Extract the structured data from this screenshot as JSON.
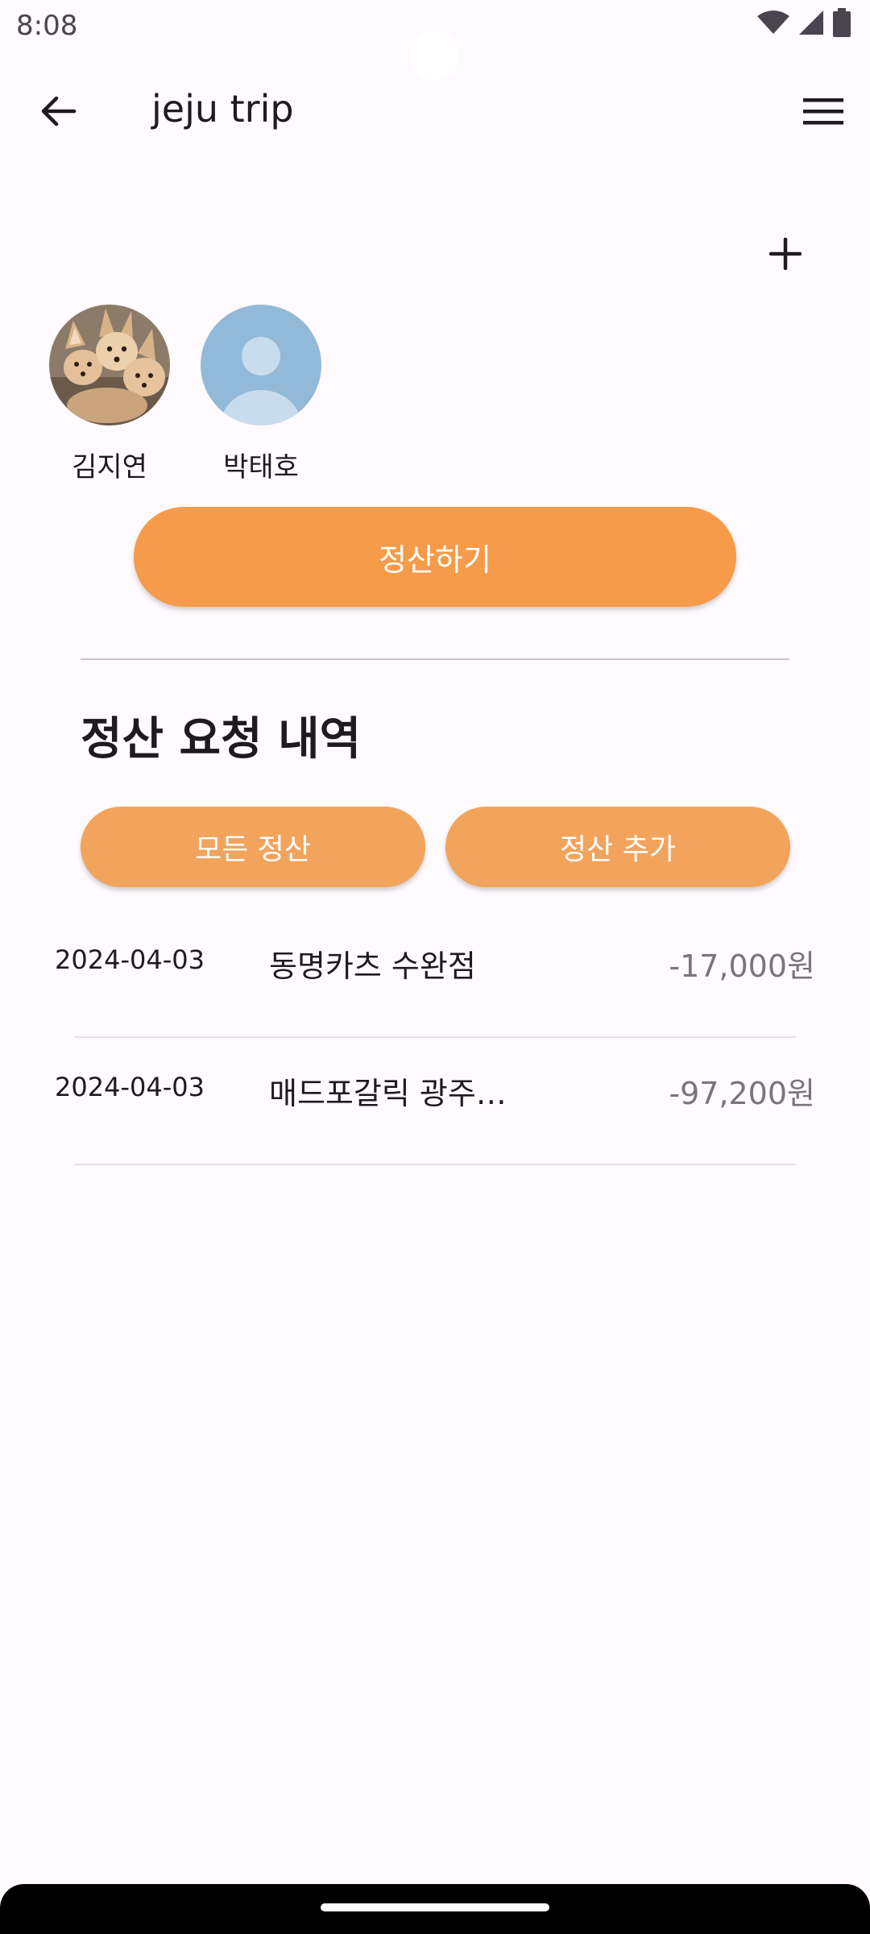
{
  "status_bar": {
    "time": "8:08"
  },
  "app_bar": {
    "title": "jeju trip"
  },
  "members": [
    {
      "name": "김지연",
      "avatar": "fennec-fox-photo"
    },
    {
      "name": "박태호",
      "avatar": "default-person"
    }
  ],
  "settle_button": {
    "label": "정산하기"
  },
  "section": {
    "title": "정산 요청 내역"
  },
  "filters": {
    "all_label": "모든 정산",
    "add_label": "정산 추가"
  },
  "transactions": [
    {
      "date": "2024-04-03",
      "description": "동명카츠 수완점",
      "amount": "-17,000원"
    },
    {
      "date": "2024-04-03",
      "description": "매드포갈릭 광주…",
      "amount": "-97,200원"
    }
  ],
  "colors": {
    "accent": "#f59b4a",
    "accent_light": "#f2a45c",
    "background": "#fffafd",
    "avatar_default": "#93b9d8"
  }
}
